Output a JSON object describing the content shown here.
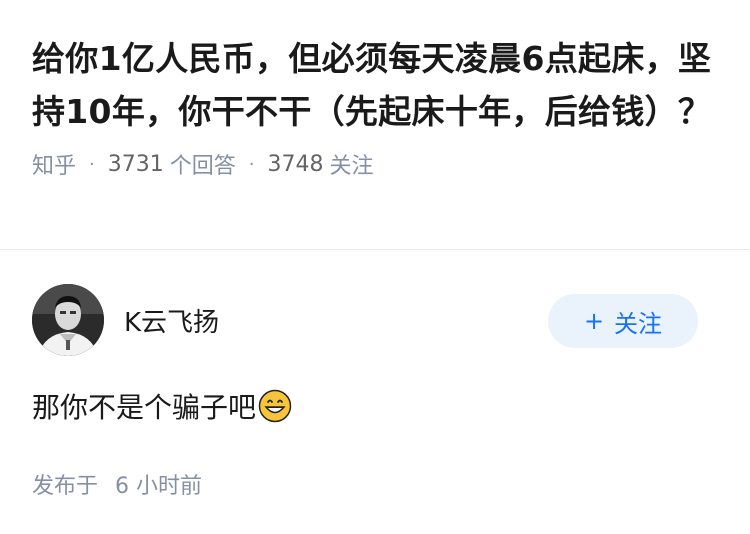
{
  "question": {
    "title": "给你1亿人民币，但必须每天凌晨6点起床，坚持10年，你干不干（先起床十年，后给钱）？",
    "source": "知乎",
    "answers_count": "3731",
    "answers_label": "个回答",
    "followers_count": "3748",
    "followers_label": "关注"
  },
  "answer": {
    "author_name": "K云飞扬",
    "follow_plus": "+",
    "follow_label": "关注",
    "text": "那你不是个骗子吧",
    "emoji": "grinning-face-emoji",
    "published_label": "发布于",
    "published_time": "6 小时前"
  },
  "colors": {
    "meta_gray": "#8590a6",
    "follow_bg": "#eaf2fb",
    "follow_text": "#1772f6"
  }
}
